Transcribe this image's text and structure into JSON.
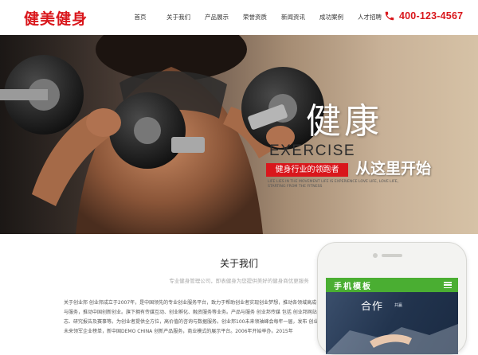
{
  "header": {
    "logo": "健美健身",
    "nav": [
      "首页",
      "关于我们",
      "产品展示",
      "荣誉资质",
      "新闻资讯",
      "成功案例",
      "人才招聘"
    ],
    "phone": "400-123-4567"
  },
  "hero": {
    "title": "健康",
    "exercise": "EXERCISE",
    "tagline": "健身行业的领跑者",
    "sub": "从这里开始",
    "english": "LIFE LIES IN THE MOVEMENT LIFE IS EXPERIENCE LOVE LIFE, LOVE LIFE, STARTING FROM THE FITNESS"
  },
  "about": {
    "title": "关于我们",
    "subtitle": "专业健身管理公司，即表健身为您提供美好的健身商优更服务",
    "body": "关于创业邦 创业邦成立于2007年，是中国领先的专业创业服务平台，致力于帮助创业者实现创业梦想，推动各领域高成长企业与服务，推动中国创新创业。旗下拥有传媒互动、创业孵化、融资服务等业务。产品与服务 创业邦传媒 包括 创业邦网站、杂志、研究报告及赛事等。为创业者提供全方位，高价值的咨询与数据服务。创业邦100未来领袖峰会每年一届，发布 创业邦100未来领军企业榜单，新中国DEMO CHINA 创新产品服务，商业模式的展示平台。2006年开始举办。2015年"
  },
  "mobile": {
    "title": "手机模板",
    "slogan": "合作",
    "slogan_small": "共赢"
  },
  "colors": {
    "brand_red": "#d9171c",
    "mobile_green": "#4aae32"
  },
  "icons": {
    "phone": "phone-icon",
    "menu": "hamburger-menu-icon"
  }
}
